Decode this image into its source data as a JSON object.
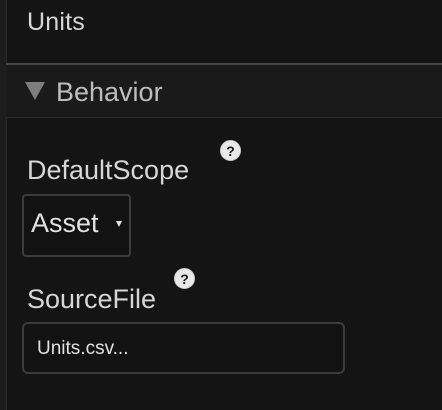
{
  "panel": {
    "title": "Units"
  },
  "section": {
    "label": "Behavior",
    "icon": "triangle-down-icon"
  },
  "fields": {
    "default_scope": {
      "label": "DefaultScope",
      "value": "Asset",
      "help_glyph": "?"
    },
    "source_file": {
      "label": "SourceFile",
      "value": "Units.csv...",
      "help_glyph": "?"
    }
  },
  "colors": {
    "background": "#141414",
    "text": "#d6d6d6",
    "input_border": "#3c3c3c",
    "help_icon": "#e9e9e9"
  }
}
